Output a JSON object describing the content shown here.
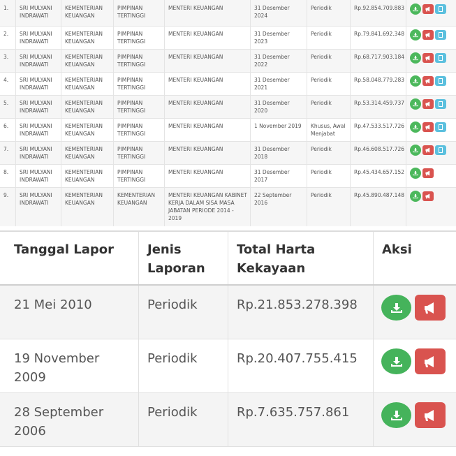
{
  "top_table": {
    "rows": [
      {
        "no": "1.",
        "name": "SRI MULYANI INDRAWATI",
        "instansi": "KEMENTERIAN KEUANGAN",
        "unit": "PIMPINAN TERTINGGI",
        "jabatan": "MENTERI KEUANGAN",
        "tanggal": "31 Desember 2024",
        "jenis": "Periodik",
        "harta": "Rp.92.854.709.883",
        "has_info": true
      },
      {
        "no": "2.",
        "name": "SRI MULYANI INDRAWATI",
        "instansi": "KEMENTERIAN KEUANGAN",
        "unit": "PIMPINAN TERTINGGI",
        "jabatan": "MENTERI KEUANGAN",
        "tanggal": "31 Desember 2023",
        "jenis": "Periodik",
        "harta": "Rp.79.841.692.348",
        "has_info": true
      },
      {
        "no": "3.",
        "name": "SRI MULYANI INDRAWATI",
        "instansi": "KEMENTERIAN KEUANGAN",
        "unit": "PIMPINAN TERTINGGI",
        "jabatan": "MENTERI KEUANGAN",
        "tanggal": "31 Desember 2022",
        "jenis": "Periodik",
        "harta": "Rp.68.717.903.184",
        "has_info": true
      },
      {
        "no": "4.",
        "name": "SRI MULYANI INDRAWATI",
        "instansi": "KEMENTERIAN KEUANGAN",
        "unit": "PIMPINAN TERTINGGI",
        "jabatan": "MENTERI KEUANGAN",
        "tanggal": "31 Desember 2021",
        "jenis": "Periodik",
        "harta": "Rp.58.048.779.283",
        "has_info": true
      },
      {
        "no": "5.",
        "name": "SRI MULYANI INDRAWATI",
        "instansi": "KEMENTERIAN KEUANGAN",
        "unit": "PIMPINAN TERTINGGI",
        "jabatan": "MENTERI KEUANGAN",
        "tanggal": "31 Desember 2020",
        "jenis": "Periodik",
        "harta": "Rp.53.314.459.737",
        "has_info": true
      },
      {
        "no": "6.",
        "name": "SRI MULYANI INDRAWATI",
        "instansi": "KEMENTERIAN KEUANGAN",
        "unit": "PIMPINAN TERTINGGI",
        "jabatan": "MENTERI KEUANGAN",
        "tanggal": "1 November 2019",
        "jenis": "Khusus, Awal Menjabat",
        "harta": "Rp.47.533.517.726",
        "has_info": true
      },
      {
        "no": "7.",
        "name": "SRI MULYANI INDRAWATI",
        "instansi": "KEMENTERIAN KEUANGAN",
        "unit": "PIMPINAN TERTINGGI",
        "jabatan": "MENTERI KEUANGAN",
        "tanggal": "31 Desember 2018",
        "jenis": "Periodik",
        "harta": "Rp.46.608.517.726",
        "has_info": true
      },
      {
        "no": "8.",
        "name": "SRI MULYANI INDRAWATI",
        "instansi": "KEMENTERIAN KEUANGAN",
        "unit": "PIMPINAN TERTINGGI",
        "jabatan": "MENTERI KEUANGAN",
        "tanggal": "31 Desember 2017",
        "jenis": "Periodik",
        "harta": "Rp.45.434.657.152",
        "has_info": false
      },
      {
        "no": "9.",
        "name": "SRI MULYANI INDRAWATI",
        "instansi": "KEMENTERIAN KEUANGAN",
        "unit": "KEMENTERIAN KEUANGAN",
        "jabatan": "MENTERI KEUANGAN KABINET KERJA DALAM SISA MASA JABATAN PERIODE 2014 - 2019",
        "tanggal": "22 September 2016",
        "jenis": "Periodik",
        "harta": "Rp.45.890.487.148",
        "has_info": false
      }
    ]
  },
  "bottom_table": {
    "headers": {
      "tanggal": "Tanggal Lapor",
      "jenis": "Jenis Laporan",
      "harta": "Total Harta Kekayaan",
      "aksi": "Aksi"
    },
    "rows": [
      {
        "tanggal": "21 Mei 2010",
        "jenis": "Periodik",
        "harta": "Rp.21.853.278.398"
      },
      {
        "tanggal": "19 November 2009",
        "jenis": "Periodik",
        "harta": "Rp.20.407.755.415"
      },
      {
        "tanggal": "28 September 2006",
        "jenis": "Periodik",
        "harta": "Rp.7.635.757.861"
      }
    ]
  },
  "icons": {
    "download": "download-icon",
    "report": "megaphone-icon",
    "info": "document-icon"
  },
  "colors": {
    "download": "#4cb85c",
    "report": "#d9534f",
    "info": "#5bc0de"
  }
}
